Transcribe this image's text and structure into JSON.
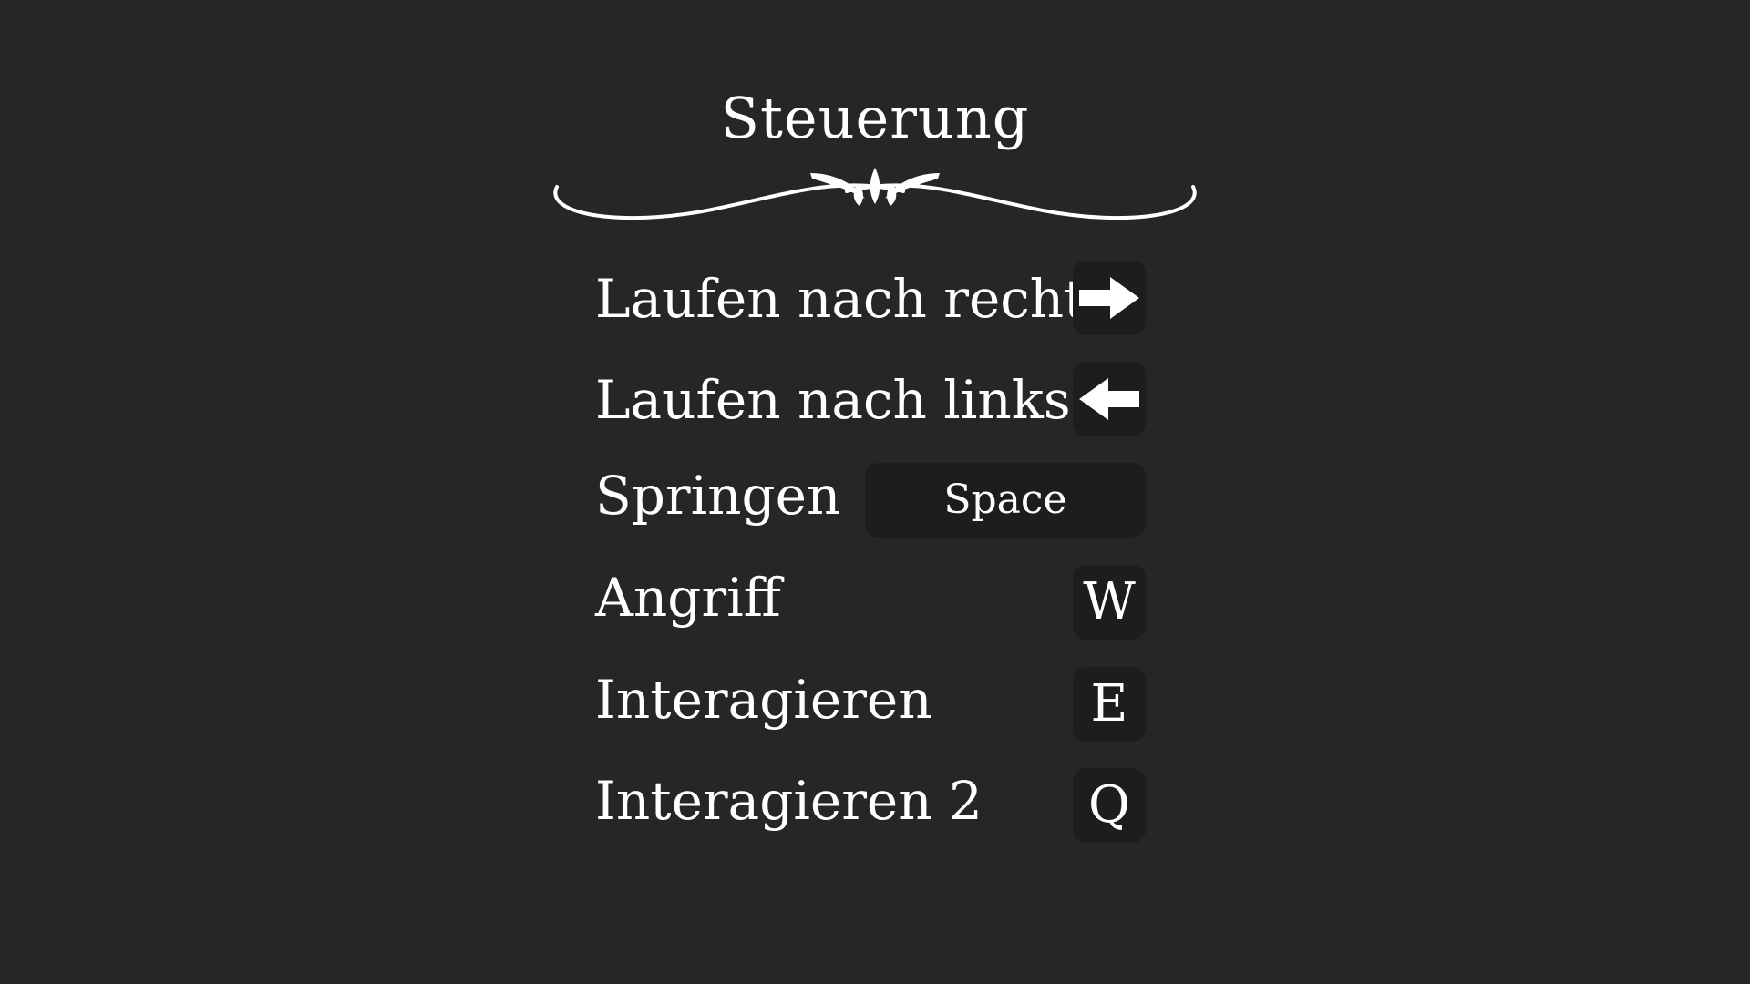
{
  "screen": {
    "title": "Steuerung",
    "background": "#262626",
    "key_background": "#1d1d1d",
    "text_color": "#ffffff"
  },
  "controls": [
    {
      "label": "Laufen nach rechts",
      "key_icon": "arrow-right-icon"
    },
    {
      "label": "Laufen nach links",
      "key_icon": "arrow-left-icon"
    },
    {
      "label": "Springen",
      "key": "Space"
    },
    {
      "label": "Angriff",
      "key": "W"
    },
    {
      "label": "Interagieren",
      "key": "E"
    },
    {
      "label": "Interagieren 2",
      "key": "Q"
    }
  ]
}
